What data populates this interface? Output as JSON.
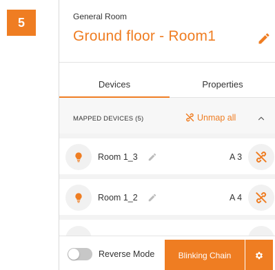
{
  "step_badge": "5",
  "header": {
    "room_type": "General Room",
    "room_name": "Ground floor - Room1"
  },
  "tabs": [
    {
      "label": "Devices",
      "active": true
    },
    {
      "label": "Properties",
      "active": false
    }
  ],
  "mapped_section": {
    "title": "MAPPED DEVICES (5)",
    "unmap_all_label": "Unmap all"
  },
  "devices": [
    {
      "name": "Room 1_3",
      "address": "A 3"
    },
    {
      "name": "Room 1_2",
      "address": "A 4"
    }
  ],
  "footer": {
    "reverse_mode_label": "Reverse Mode",
    "reverse_mode_on": false,
    "blinking_chain_label": "Blinking Chain"
  },
  "colors": {
    "accent": "#ef7d22",
    "light_bg": "#f1f1f1",
    "text": "#333333"
  }
}
